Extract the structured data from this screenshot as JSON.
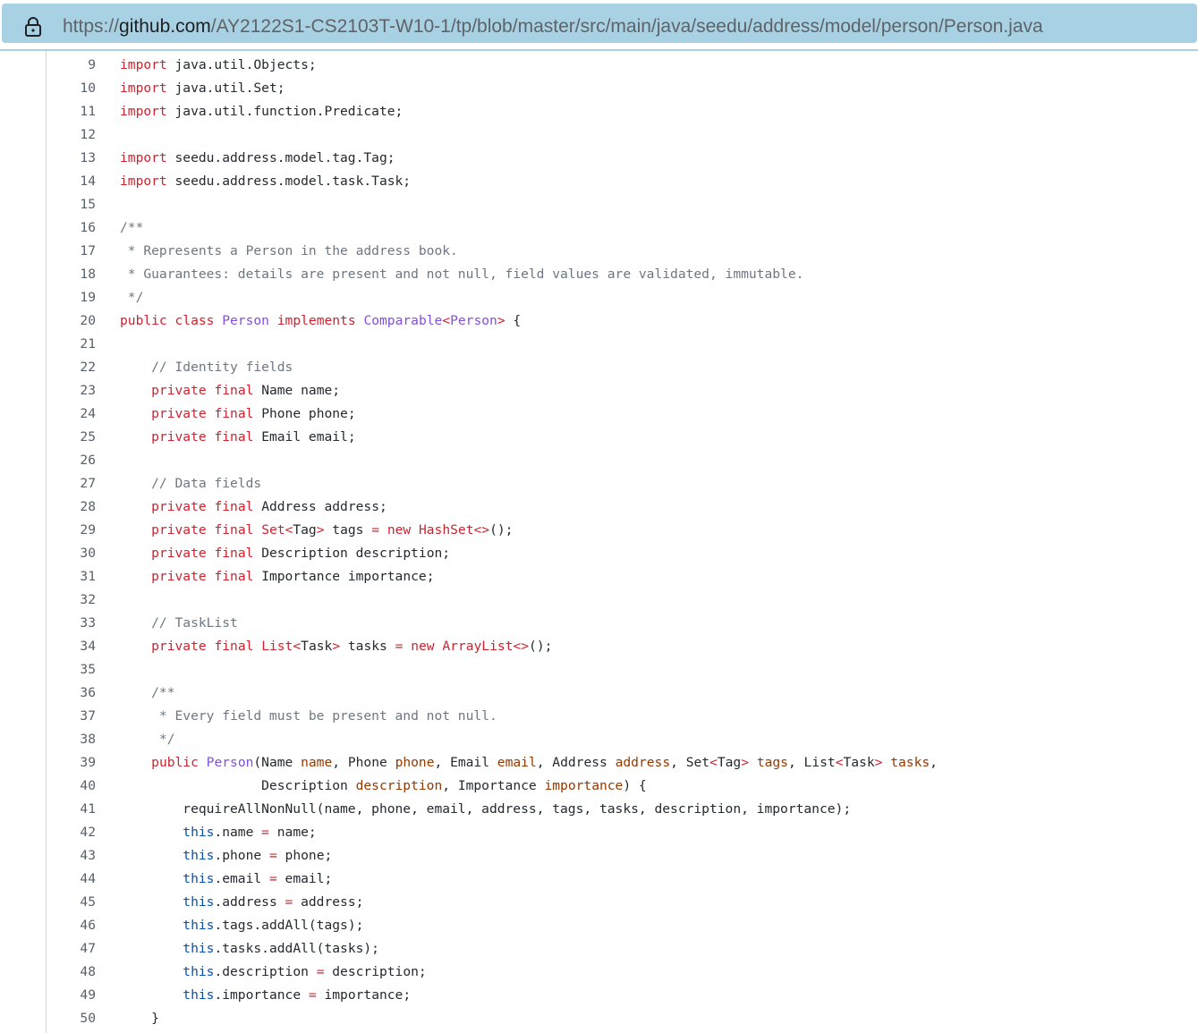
{
  "browser": {
    "url_prefix": "https://",
    "url_host": "github.com",
    "url_path": "/AY2122S1-CS2103T-W10-1/tp/blob/master/src/main/java/seedu/address/model/person/Person.java",
    "lock_icon": "lock-icon"
  },
  "code": {
    "language": "java",
    "lines": [
      {
        "n": "9",
        "src": "import java.util.Objects;"
      },
      {
        "n": "10",
        "src": "import java.util.Set;"
      },
      {
        "n": "11",
        "src": "import java.util.function.Predicate;"
      },
      {
        "n": "12",
        "src": ""
      },
      {
        "n": "13",
        "src": "import seedu.address.model.tag.Tag;"
      },
      {
        "n": "14",
        "src": "import seedu.address.model.task.Task;"
      },
      {
        "n": "15",
        "src": ""
      },
      {
        "n": "16",
        "src": "/**"
      },
      {
        "n": "17",
        "src": " * Represents a Person in the address book."
      },
      {
        "n": "18",
        "src": " * Guarantees: details are present and not null, field values are validated, immutable."
      },
      {
        "n": "19",
        "src": " */"
      },
      {
        "n": "20",
        "src": "public class Person implements Comparable<Person> {"
      },
      {
        "n": "21",
        "src": ""
      },
      {
        "n": "22",
        "src": "    // Identity fields"
      },
      {
        "n": "23",
        "src": "    private final Name name;"
      },
      {
        "n": "24",
        "src": "    private final Phone phone;"
      },
      {
        "n": "25",
        "src": "    private final Email email;"
      },
      {
        "n": "26",
        "src": ""
      },
      {
        "n": "27",
        "src": "    // Data fields"
      },
      {
        "n": "28",
        "src": "    private final Address address;"
      },
      {
        "n": "29",
        "src": "    private final Set<Tag> tags = new HashSet<>();"
      },
      {
        "n": "30",
        "src": "    private final Description description;"
      },
      {
        "n": "31",
        "src": "    private final Importance importance;"
      },
      {
        "n": "32",
        "src": ""
      },
      {
        "n": "33",
        "src": "    // TaskList"
      },
      {
        "n": "34",
        "src": "    private final List<Task> tasks = new ArrayList<>();"
      },
      {
        "n": "35",
        "src": ""
      },
      {
        "n": "36",
        "src": "    /**"
      },
      {
        "n": "37",
        "src": "     * Every field must be present and not null."
      },
      {
        "n": "38",
        "src": "     */"
      },
      {
        "n": "39",
        "src": "    public Person(Name name, Phone phone, Email email, Address address, Set<Tag> tags, List<Task> tasks,"
      },
      {
        "n": "40",
        "src": "                  Description description, Importance importance) {"
      },
      {
        "n": "41",
        "src": "        requireAllNonNull(name, phone, email, address, tags, tasks, description, importance);"
      },
      {
        "n": "42",
        "src": "        this.name = name;"
      },
      {
        "n": "43",
        "src": "        this.phone = phone;"
      },
      {
        "n": "44",
        "src": "        this.email = email;"
      },
      {
        "n": "45",
        "src": "        this.address = address;"
      },
      {
        "n": "46",
        "src": "        this.tags.addAll(tags);"
      },
      {
        "n": "47",
        "src": "        this.tasks.addAll(tasks);"
      },
      {
        "n": "48",
        "src": "        this.description = description;"
      },
      {
        "n": "49",
        "src": "        this.importance = importance;"
      },
      {
        "n": "50",
        "src": "    }"
      }
    ]
  },
  "colors": {
    "keyword": "#cf222e",
    "comment": "#6e7781",
    "entity": "#8250df",
    "param": "#953800",
    "this": "#0550ae",
    "address_bar": "#a8d1e3"
  }
}
